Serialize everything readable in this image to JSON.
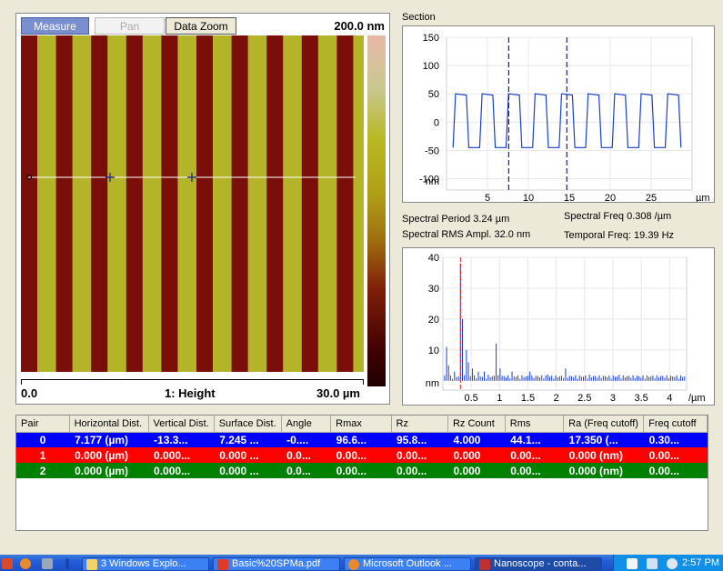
{
  "toolbar": {
    "measure_label": "Measure",
    "pan_label": "Pan",
    "zoom_label": "Data Zoom"
  },
  "image": {
    "scale_top": "200.0 nm",
    "axis_left": "0.0",
    "channel": "1: Height",
    "axis_right": "30.0 µm",
    "colors": {
      "stripe_light": "#b4b428",
      "stripe_dark": "#7a0f0a",
      "line": "#ffffff"
    }
  },
  "section": {
    "title": "Section",
    "x_unit": "µm",
    "y_unit": "nm",
    "y_ticks": [
      "150",
      "100",
      "50",
      "0",
      "-50",
      "-100"
    ],
    "x_ticks": [
      "5",
      "10",
      "15",
      "20",
      "25"
    ]
  },
  "spectral": {
    "period": "Spectral Period 3.24 µm",
    "freq": "Spectral Freq 0.308 /µm",
    "rms": "Spectral RMS Ampl. 32.0 nm",
    "temporal": "Temporal Freq: 19.39 Hz"
  },
  "spectrum": {
    "y_unit": "nm",
    "x_unit": "/µm",
    "y_ticks": [
      "40",
      "30",
      "20",
      "10"
    ],
    "x_ticks": [
      "0.5",
      "1",
      "1.5",
      "2",
      "2.5",
      "3",
      "3.5",
      "4"
    ]
  },
  "table": {
    "headers": [
      "Pair",
      "Horizontal Dist.",
      "Vertical Dist.",
      "Surface Dist.",
      "Angle",
      "Rmax",
      "Rz",
      "Rz Count",
      "Rms",
      "Ra (Freq cutoff)",
      "Freq cutoff"
    ],
    "rows": [
      [
        "0",
        "7.177 (µm)",
        "-13.3...",
        "7.245 ...",
        "-0....",
        "96.6...",
        "95.8...",
        "4.000",
        "44.1...",
        "17.350 (...",
        "0.30..."
      ],
      [
        "1",
        "0.000 (µm)",
        "0.000...",
        "0.000 ...",
        "0.0...",
        "0.00...",
        "0.00...",
        "0.000",
        "0.00...",
        "0.000 (nm)",
        "0.00..."
      ],
      [
        "2",
        "0.000 (µm)",
        "0.000...",
        "0.000 ...",
        "0.0...",
        "0.00...",
        "0.00...",
        "0.000",
        "0.00...",
        "0.000 (nm)",
        "0.00..."
      ]
    ]
  },
  "taskbar": {
    "items": [
      {
        "label": "3 Windows Explo...",
        "icon": "folder-icon"
      },
      {
        "label": "Basic%20SPMa.pdf",
        "icon": "pdf-icon"
      },
      {
        "label": "Microsoft Outlook ...",
        "icon": "outlook-icon"
      },
      {
        "label": "Nanoscope - conta...",
        "icon": "nanoscope-icon"
      }
    ],
    "clock": "2:57 PM"
  }
}
